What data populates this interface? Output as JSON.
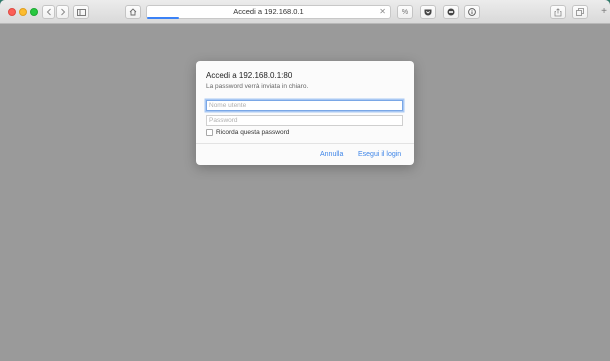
{
  "browser": {
    "address": "Accedi a 192.168.0.1",
    "new_tab": "+"
  },
  "dialog": {
    "title": "Accedi a 192.168.0.1:80",
    "subtitle": "La password verrà inviata in chiaro.",
    "username_placeholder": "Nome utente",
    "password_placeholder": "Password",
    "remember_label": "Ricorda questa password",
    "cancel_label": "Annulla",
    "login_label": "Esegui il login"
  },
  "colors": {
    "page_background": "#9a9a9a",
    "accent": "#3f86e8"
  }
}
